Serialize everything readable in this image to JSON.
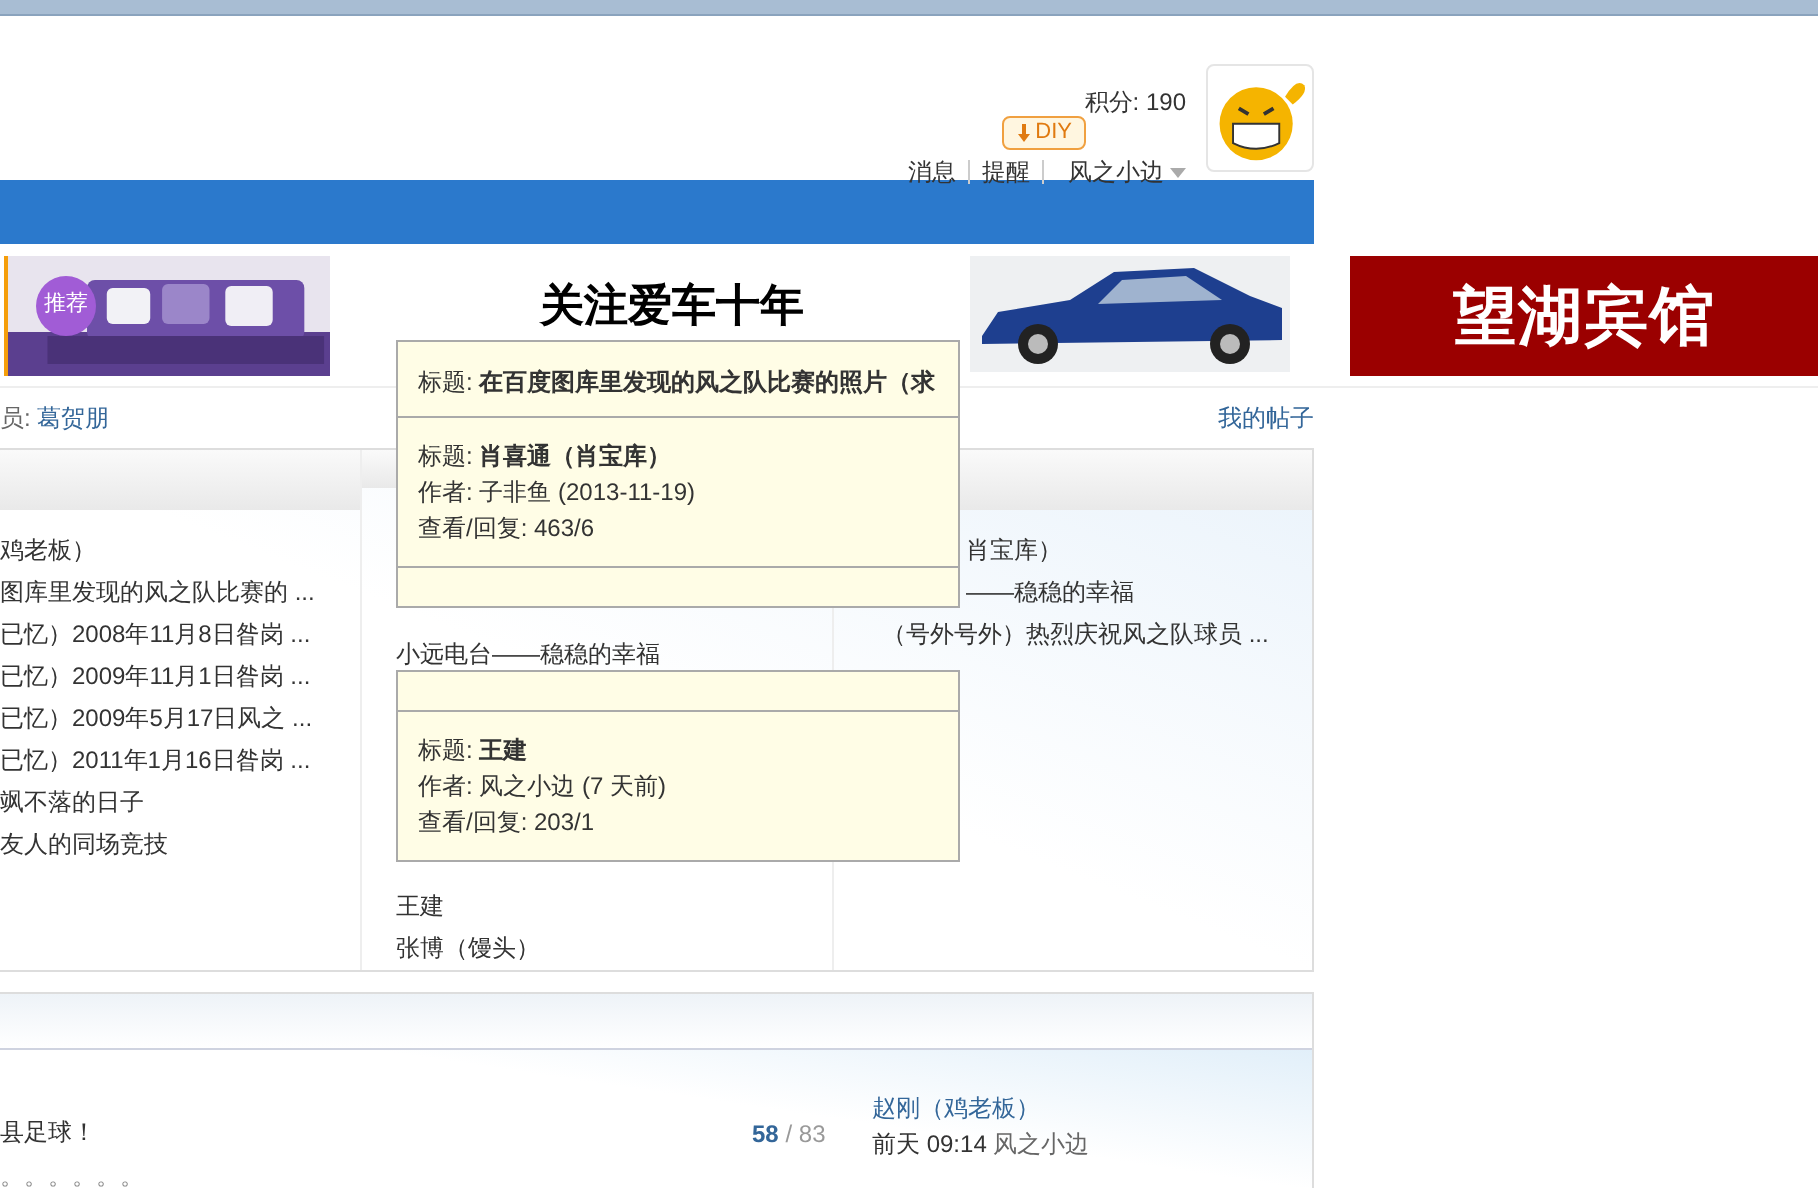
{
  "header": {
    "points": "积分: 190",
    "diy_button": "DIY",
    "links": [
      {
        "label": "消息"
      },
      {
        "label": "提醒"
      },
      {
        "label": "风之小边",
        "dropdown": true
      }
    ]
  },
  "banners": [
    {
      "kind": "picture",
      "badge": "推荐"
    },
    {
      "kind": "car",
      "headline": "关注爱车十年"
    },
    {
      "kind": "hotel",
      "headline": "望湖宾馆"
    }
  ],
  "member_bar": {
    "label": "员:",
    "name": "葛贺朋",
    "my_posts": "我的帖子"
  },
  "columns": [
    {
      "items": [
        {
          "text": "鸡老板）"
        },
        {
          "text": "图库里发现的风之队比赛的 ..."
        },
        {
          "text": "已忆）2008年11月8日昝岗 ..."
        },
        {
          "text": "已忆）2009年11月1日昝岗 ..."
        },
        {
          "text": "已忆）2009年5月17日风之 ..."
        },
        {
          "text": "已忆）2011年1月16日昝岗 ..."
        },
        {
          "text": "飒不落的日子"
        },
        {
          "text": "友人的同场竞技"
        }
      ]
    },
    {
      "items": [
        {
          "text": "小远电台——稳稳的幸福"
        },
        {
          "text": "王建"
        },
        {
          "text": "张博（馒头）"
        }
      ]
    },
    {
      "items": [
        {
          "text": "肖宝库）",
          "clipped": true
        },
        {
          "text": "——稳稳的幸福",
          "clipped": true
        },
        {
          "text": "（号外号外）热烈庆祝风之队球员 ...",
          "clipped": false
        }
      ]
    }
  ],
  "tooltips": [
    {
      "kind": "behind",
      "lines": [
        "标题: **在百度图库里发现的风之队比赛的照片（求**"
      ]
    },
    {
      "kind": "front",
      "lines": [
        "标题: **肖喜通（肖宝库）**",
        "作者: 子非鱼 (2013-11-19)",
        "查看/回复: 463/6"
      ]
    },
    {
      "kind": "behind"
    },
    {
      "kind": "front",
      "lines": [
        "标题: **王建**",
        "作者: 风之小边 (7 天前)",
        "查看/回复: 203/1"
      ]
    }
  ],
  "thread_list": {
    "rows": [
      {
        "title": "县足球！",
        "replies": "58",
        "separator": "/",
        "views": "83",
        "last_post_title": "赵刚（鸡老板）",
        "last_post_time": "前天 09:14",
        "last_post_author": "风之小边",
        "excerpt": "。。。。。。"
      }
    ]
  }
}
